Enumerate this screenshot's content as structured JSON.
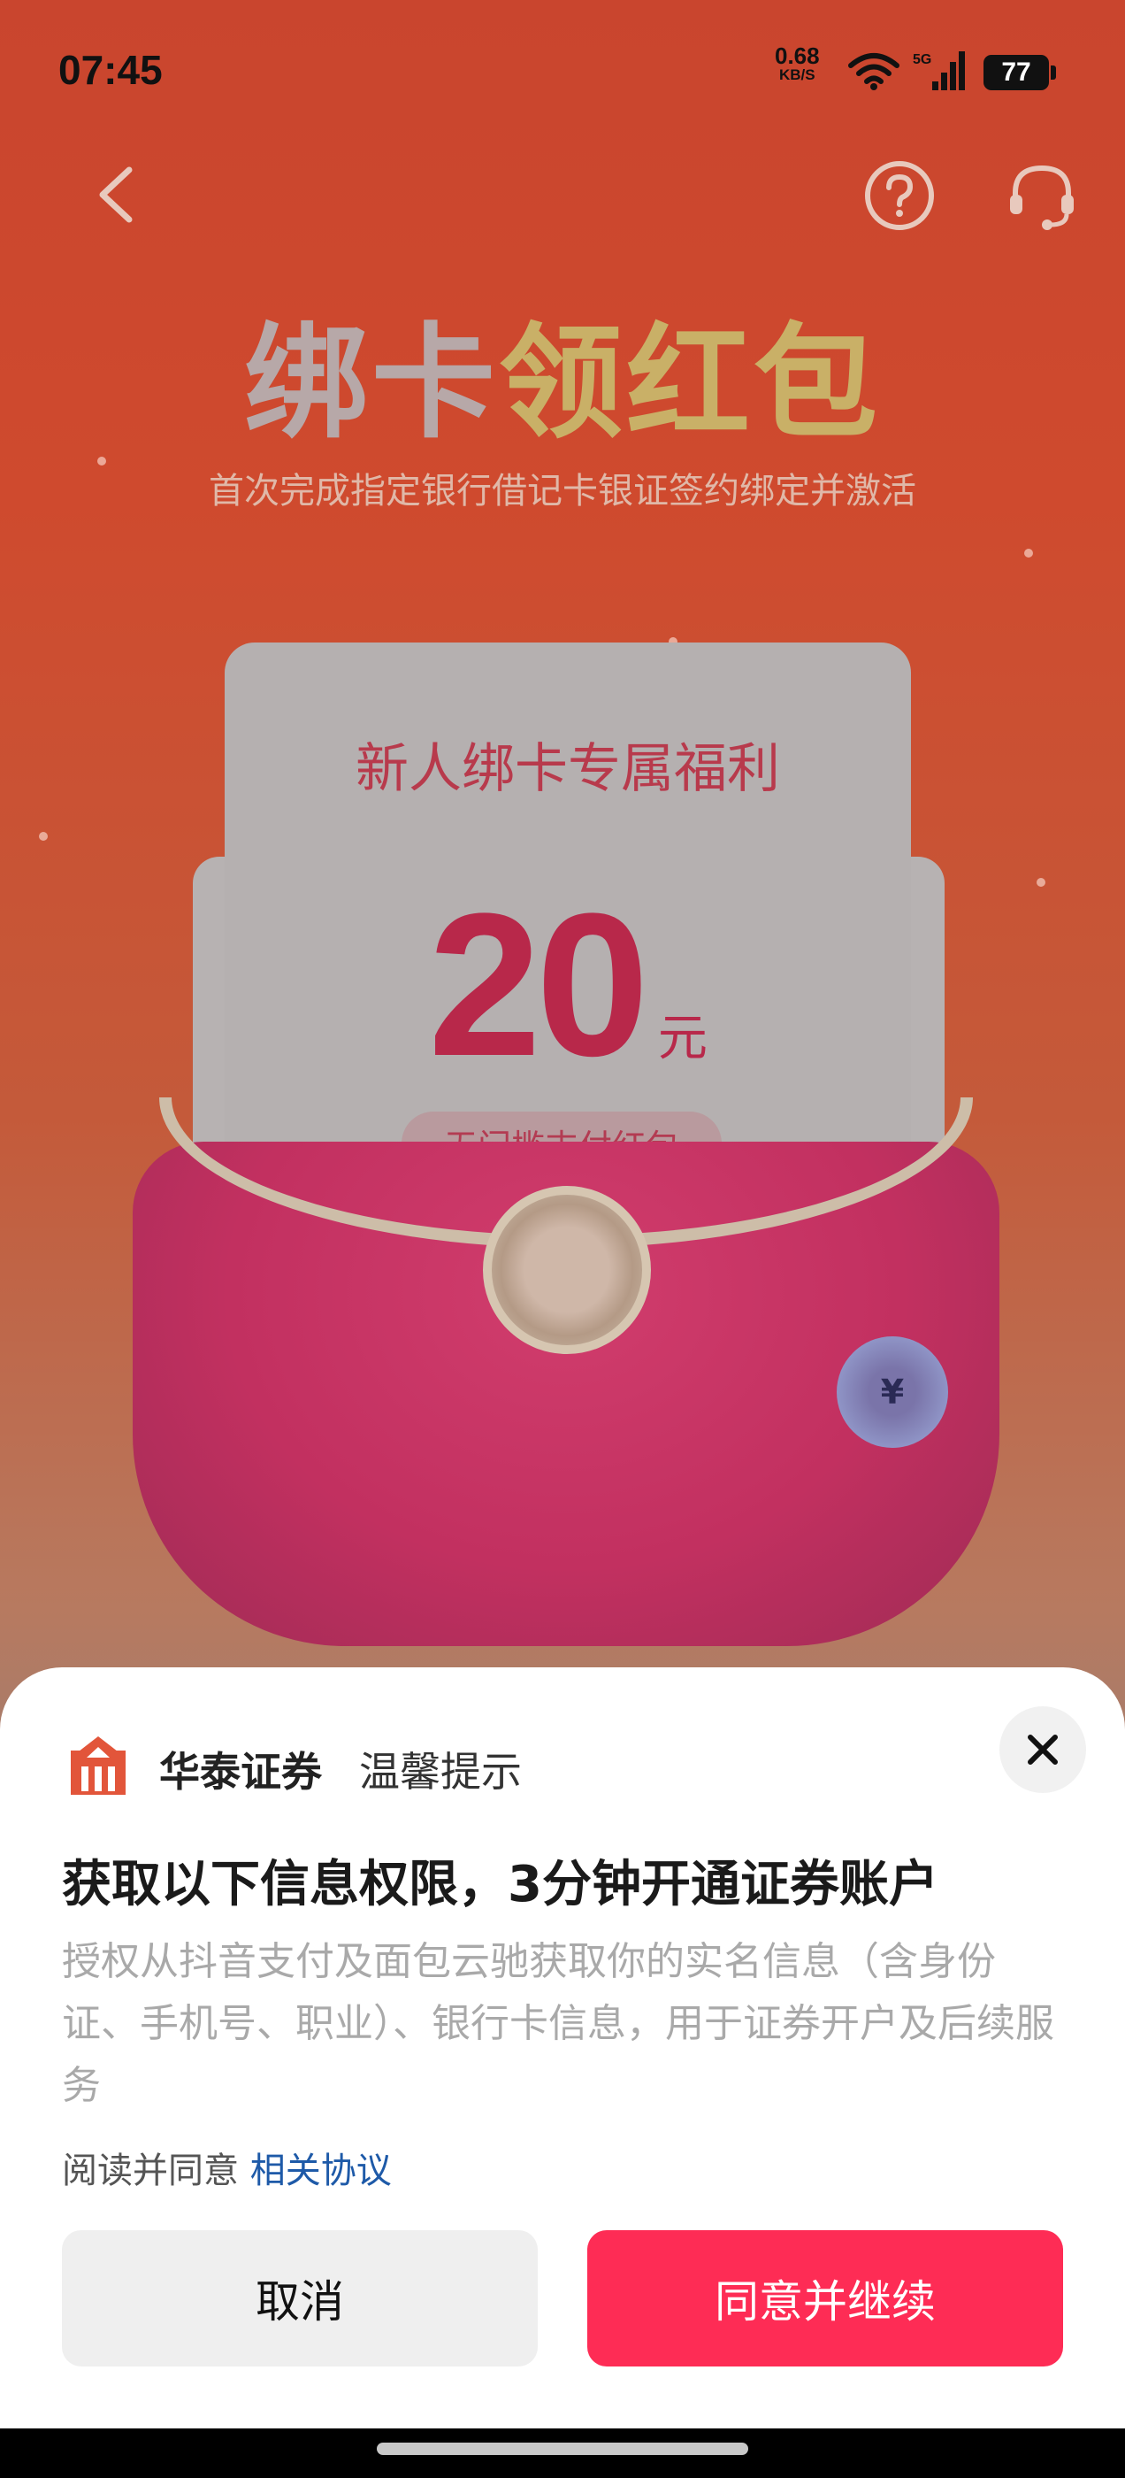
{
  "status_bar": {
    "time": "07:45",
    "net_speed": "0.68",
    "net_unit": "KB/S",
    "network": "5G",
    "battery": "77"
  },
  "header": {
    "title_part1": "绑卡",
    "title_part2": "领红包",
    "subtitle": "首次完成指定银行借记卡银证签约绑定并激活"
  },
  "promo_card": {
    "title": "新人绑卡专属福利",
    "amount": "20",
    "unit": "元",
    "tag": "无门槛支付红包",
    "coin_symbol": "¥"
  },
  "sheet": {
    "brand": "华泰证券",
    "brand_sub": "温馨提示",
    "title": "获取以下信息权限，3分钟开通证券账户",
    "description": "授权从抖音支付及面包云驰获取你的实名信息（含身份证、手机号、职业）、银行卡信息，用于证券开户及后续服务",
    "agree_prefix": "阅读并同意",
    "agree_link": "相关协议",
    "cancel_label": "取消",
    "confirm_label": "同意并继续"
  },
  "colors": {
    "accent": "#fe2c55",
    "link": "#1e5aa8",
    "brand_logo": "#e2553a"
  }
}
